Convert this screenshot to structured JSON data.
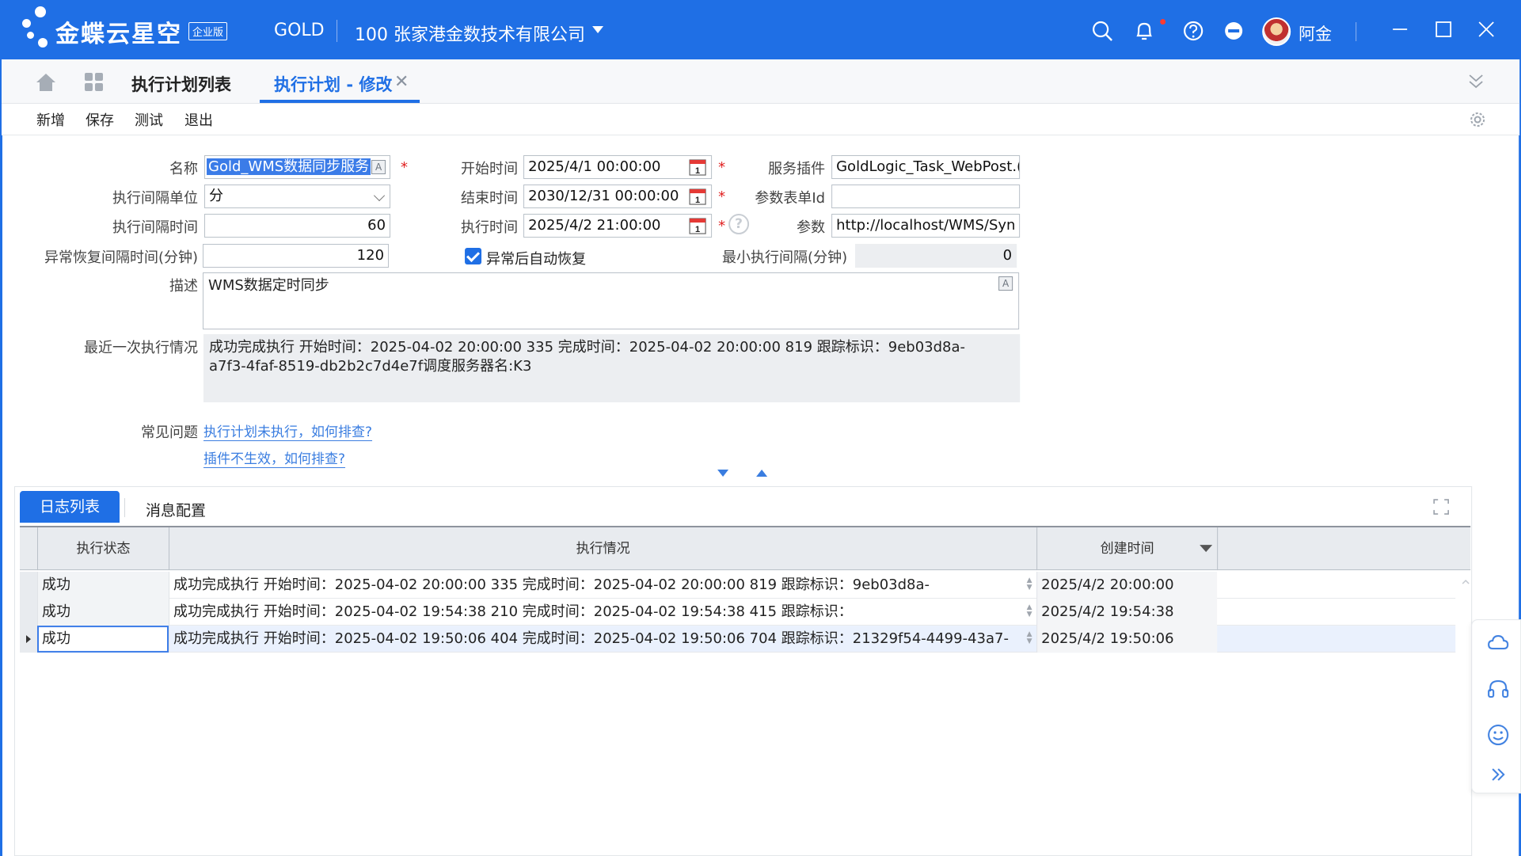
{
  "header": {
    "brand": "金蝶云星空",
    "brand_badge": "企业版",
    "tenant": "GOLD",
    "company": "100  张家港金数技术有限公司",
    "username": "阿金"
  },
  "tabs": {
    "list_label": "执行计划列表",
    "active_label": "执行计划 - 修改"
  },
  "toolbar": {
    "add": "新增",
    "save": "保存",
    "test": "测试",
    "exit": "退出"
  },
  "form": {
    "name_label": "名称",
    "name_value": "Gold_WMS数据同步服务",
    "interval_unit_label": "执行间隔单位",
    "interval_unit_value": "分",
    "interval_time_label": "执行间隔时间",
    "interval_time_value": "60",
    "recover_interval_label": "异常恢复间隔时间(分钟)",
    "recover_interval_value": "120",
    "start_time_label": "开始时间",
    "start_time_value": "2025/4/1 00:00:00",
    "end_time_label": "结束时间",
    "end_time_value": "2030/12/31 00:00:00",
    "exec_time_label": "执行时间",
    "exec_time_value": "2025/4/2 21:00:00",
    "auto_recover_label": "异常后自动恢复",
    "service_plugin_label": "服务插件",
    "service_plugin_value": "GoldLogic_Task_WebPost.(",
    "param_form_label": "参数表单Id",
    "param_form_value": "",
    "param_label": "参数",
    "param_value": "http://localhost/WMS/Syn",
    "min_interval_label": "最小执行间隔(分钟)",
    "min_interval_value": "0",
    "desc_label": "描述",
    "desc_value": "WMS数据定时同步",
    "last_exec_label": "最近一次执行情况",
    "last_exec_line1": "成功完成执行  开始时间：2025-04-02 20:00:00 335  完成时间：2025-04-02 20:00:00 819  跟踪标识：9eb03d8a-",
    "last_exec_line2": "a7f3-4faf-8519-db2b2c7d4e7f调度服务器名:K3",
    "faq_label": "常见问题",
    "faq_link1": "执行计划未执行，如何排查?",
    "faq_link2": "插件不生效，如何排查?"
  },
  "bottom_tabs": {
    "log_list": "日志列表",
    "msg_config": "消息配置"
  },
  "grid": {
    "columns": [
      "执行状态",
      "执行情况",
      "创建时间"
    ],
    "rows": [
      {
        "status": "成功",
        "detail": "成功完成执行  开始时间：2025-04-02 20:00:00 335  完成时间：2025-04-02 20:00:00 819  跟踪标识：9eb03d8a-",
        "created": "2025/4/2 20:00:00"
      },
      {
        "status": "成功",
        "detail": "成功完成执行  开始时间：2025-04-02 19:54:38 210  完成时间：2025-04-02 19:54:38 415  跟踪标识：",
        "created": "2025/4/2 19:54:38"
      },
      {
        "status": "成功",
        "detail": "成功完成执行  开始时间：2025-04-02 19:50:06 404  完成时间：2025-04-02 19:50:06 704  跟踪标识：21329f54-4499-43a7-",
        "created": "2025/4/2 19:50:06"
      }
    ]
  },
  "colors": {
    "accent": "#1f6fe5",
    "required": "#e02020",
    "link": "#3a7de0"
  }
}
